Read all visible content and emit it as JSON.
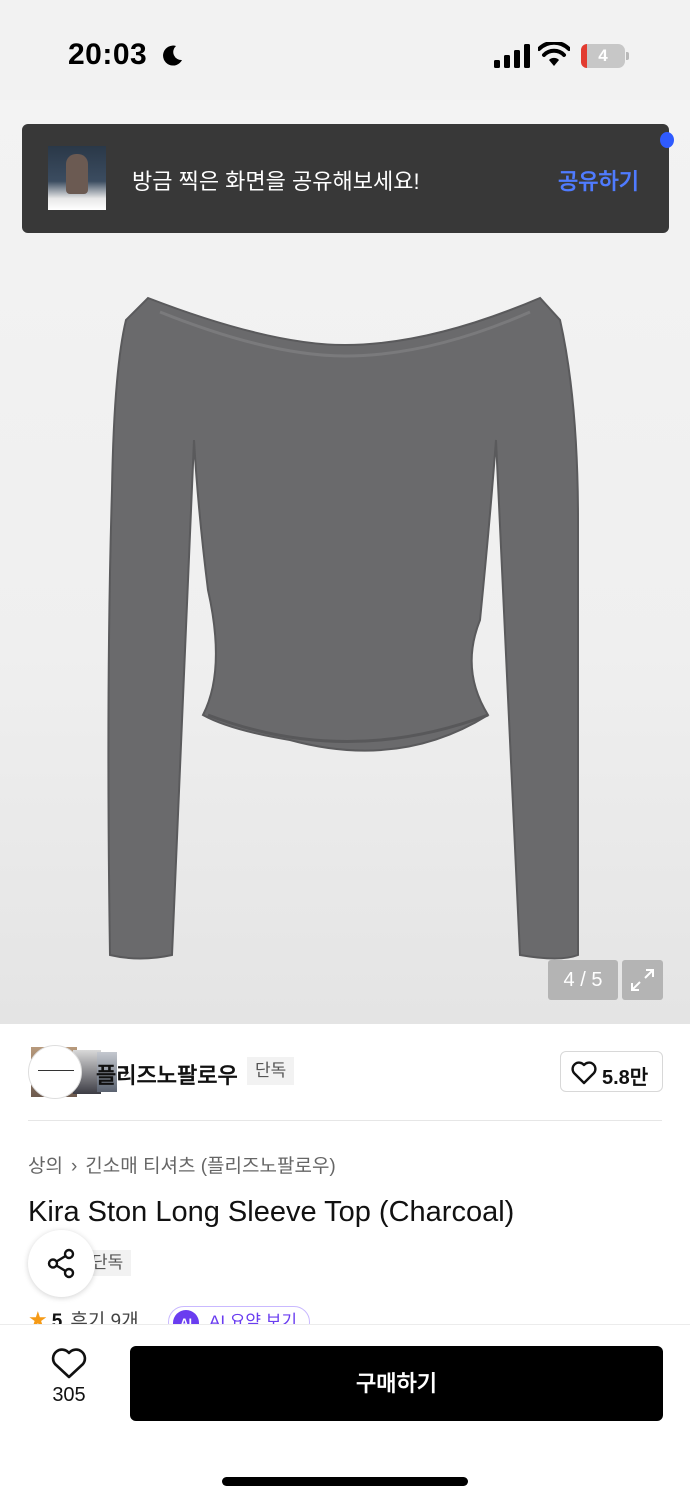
{
  "status_bar": {
    "time": "20:03",
    "battery": "4"
  },
  "share_toast": {
    "message": "방금 찍은 화면을 공유해보세요!",
    "action": "공유하기"
  },
  "gallery": {
    "counter": "4 / 5",
    "garment_color": "#6a6a6c"
  },
  "brand": {
    "name": "플리즈노팔로우",
    "badge": "단독",
    "likes": "5.8만"
  },
  "product": {
    "breadcrumb": [
      "상의",
      "긴소매 티셔츠 (플리즈노팔로우)"
    ],
    "title": "Kira Ston Long Sleeve Top (Charcoal)",
    "badge": "단독",
    "rating": "5",
    "reviews": "후기 9개",
    "ai_label": "AI 요약 보기",
    "ai_icon": "AI"
  },
  "bottom_bar": {
    "wish_count": "305",
    "buy_label": "구매하기"
  },
  "colors": {
    "accent_blue": "#4f7bff",
    "buy_button": "#000000",
    "star": "#f59a16",
    "ai_purple": "#6a3df0"
  }
}
